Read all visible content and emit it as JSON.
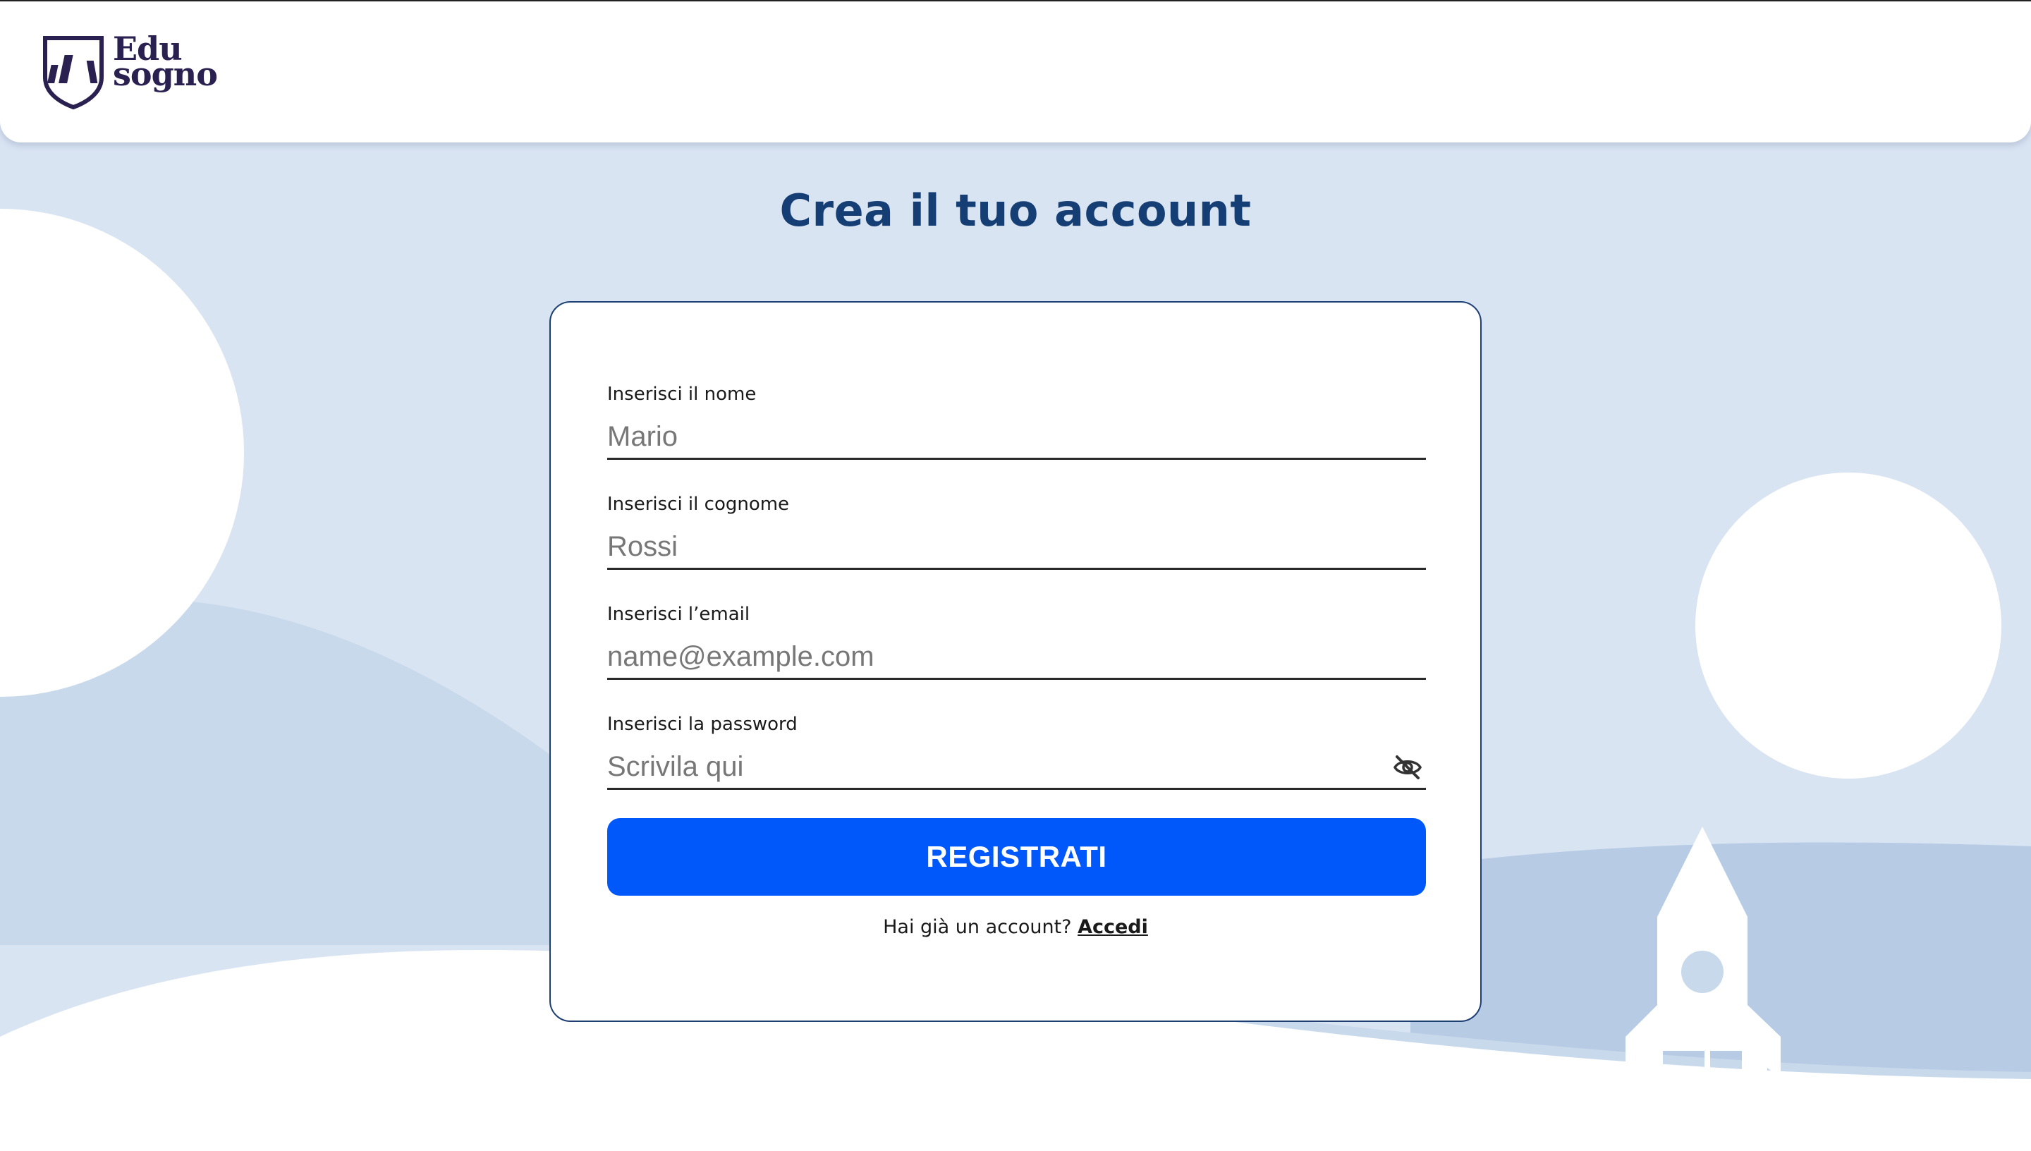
{
  "brand": {
    "name_line1": "Edu",
    "name_line2": "sogno",
    "logo_icon": "shield-books-icon",
    "color": "#2b2150"
  },
  "page": {
    "title": "Crea il tuo account"
  },
  "form": {
    "first_name": {
      "label": "Inserisci il nome",
      "value": "",
      "placeholder": "Mario"
    },
    "last_name": {
      "label": "Inserisci il cognome",
      "value": "",
      "placeholder": "Rossi"
    },
    "email": {
      "label": "Inserisci l’email",
      "value": "",
      "placeholder": "name@example.com"
    },
    "password": {
      "label": "Inserisci la password",
      "value": "",
      "placeholder": "Scrivila qui",
      "toggle_icon": "eye-slash-icon"
    },
    "submit_label": "REGISTRATI",
    "login_prompt": "Hai già un account?",
    "login_link": "Accedi"
  },
  "colors": {
    "accent": "#0058fb",
    "title": "#153e75",
    "card_border": "#1d3f74",
    "background": "#d9e4f3"
  },
  "decor": {
    "illustration_icon": "rocket-icon"
  }
}
